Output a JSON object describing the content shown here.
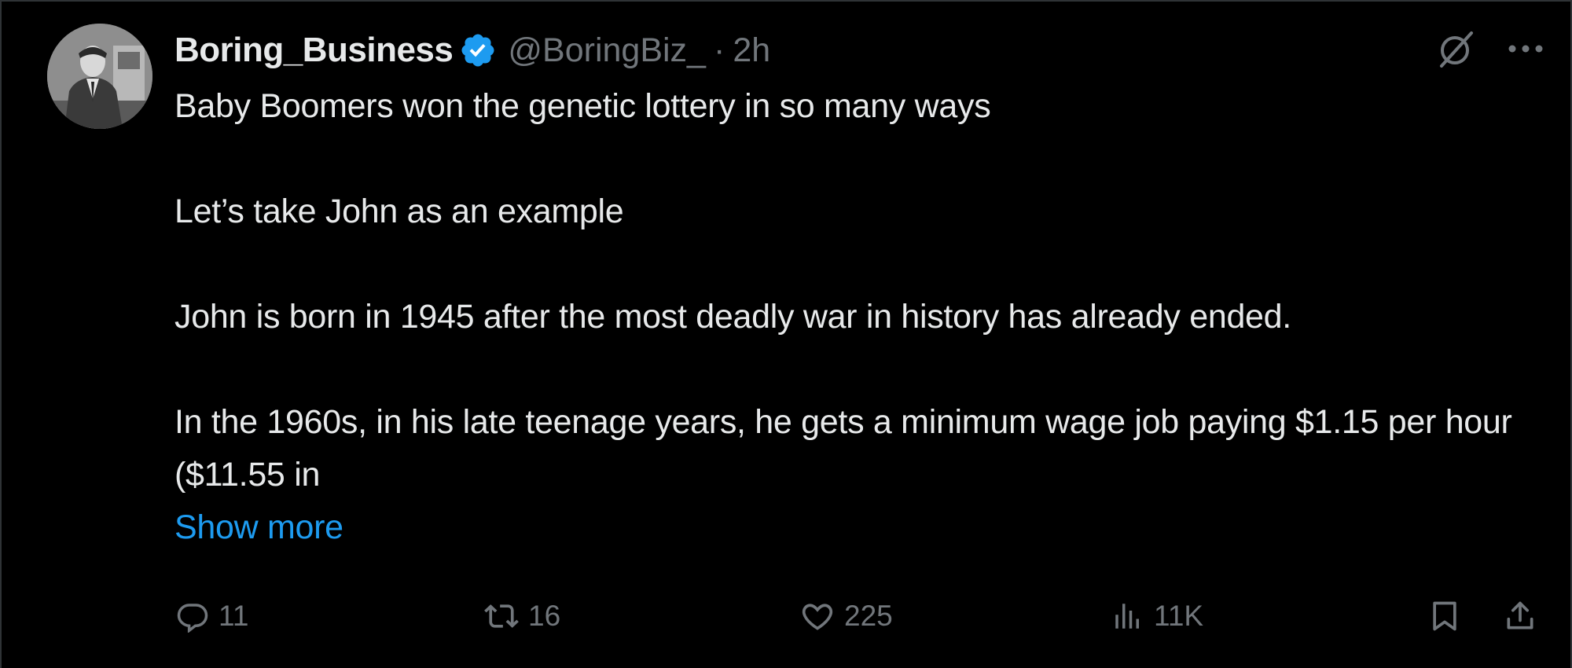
{
  "tweet": {
    "author": {
      "display_name": "Boring_Business",
      "handle": "@BoringBiz_",
      "verified": true,
      "avatar_icon": "person-portrait-avatar"
    },
    "separator": "·",
    "time": "2h",
    "paragraphs": [
      "Baby Boomers won the genetic lottery in so many ways",
      "Let’s take John as an example",
      "John is born in 1945 after the most deadly war in history has already ended.",
      "In the 1960s, in his late teenage years, he gets a minimum wage job paying $1.15 per hour ($11.55 in"
    ],
    "show_more": "Show more",
    "top_icons": [
      "grok-slash-circle-icon",
      "more-horizontal-icon"
    ],
    "actions": {
      "reply_count": "11",
      "retweet_count": "16",
      "like_count": "225",
      "views_count": "11K"
    },
    "colors": {
      "background": "#000000",
      "text": "#e7e9ea",
      "secondary": "#71767b",
      "accent": "#1d9bf0"
    }
  }
}
